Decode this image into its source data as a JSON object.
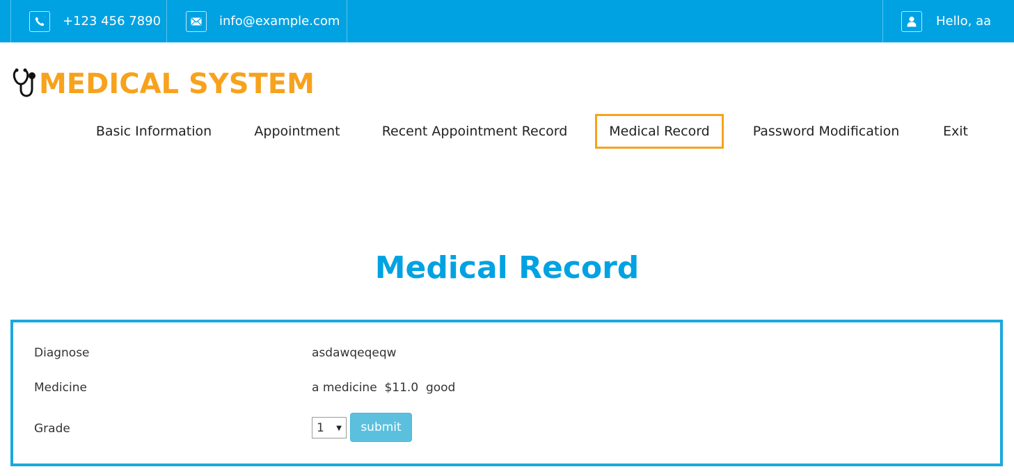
{
  "topbar": {
    "phone": "+123 456 7890",
    "email": "info@example.com",
    "greeting": "Hello, aa",
    "background": "#00a2e2"
  },
  "logo": {
    "text": "MEDICAL SYSTEM",
    "color": "#f7a21d"
  },
  "nav": {
    "items": [
      {
        "label": "Basic Information"
      },
      {
        "label": "Appointment"
      },
      {
        "label": "Recent Appointment Record"
      },
      {
        "label": "Medical Record",
        "active": true
      },
      {
        "label": "Password Modification"
      },
      {
        "label": "Exit"
      }
    ],
    "active_color": "#f7a21d"
  },
  "page": {
    "title": "Medical Record",
    "title_color": "#00a2e2"
  },
  "record": {
    "diagnose_label": "Diagnose",
    "diagnose_value": "asdawqeqeqw",
    "medicine_label": "Medicine",
    "medicine_value": "a medicine  $11.0  good",
    "grade_label": "Grade",
    "grade_selected": "1",
    "submit_label": "submit",
    "submit_color": "#5bc0de"
  },
  "icons": {
    "phone": "phone-icon",
    "email": "envelope-icon",
    "user": "user-icon",
    "logo": "stethoscope-icon"
  }
}
